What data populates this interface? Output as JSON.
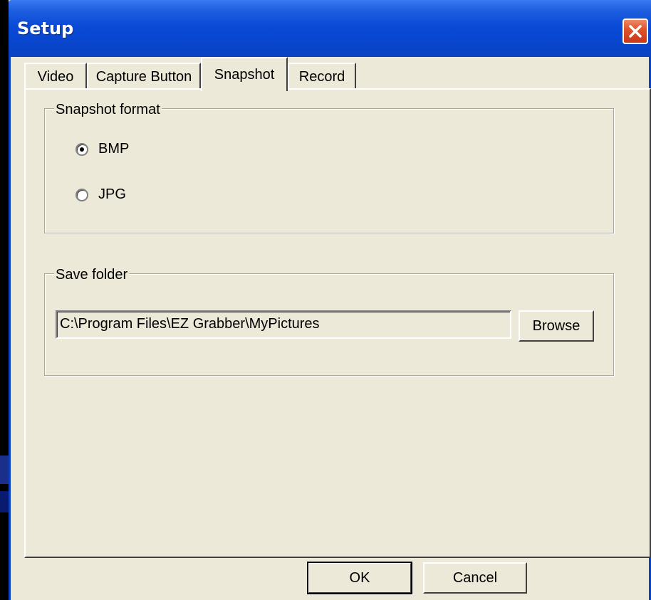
{
  "window": {
    "title": "Setup"
  },
  "tabs": [
    {
      "label": "Video"
    },
    {
      "label": "Capture Button"
    },
    {
      "label": "Snapshot",
      "active": true
    },
    {
      "label": "Record"
    }
  ],
  "snapshot_format": {
    "legend": "Snapshot format",
    "options": [
      {
        "label": "BMP",
        "selected": true
      },
      {
        "label": "JPG",
        "selected": false
      }
    ]
  },
  "save_folder": {
    "legend": "Save folder",
    "path_value": "C:\\Program Files\\EZ Grabber\\MyPictures",
    "browse_label": "Browse"
  },
  "footer": {
    "ok_label": "OK",
    "cancel_label": "Cancel"
  },
  "icons": {
    "close": "close-icon"
  },
  "colors": {
    "titlebar": "#0a4ad6",
    "close_button": "#e0542a",
    "dialog_face": "#ece9d8"
  }
}
